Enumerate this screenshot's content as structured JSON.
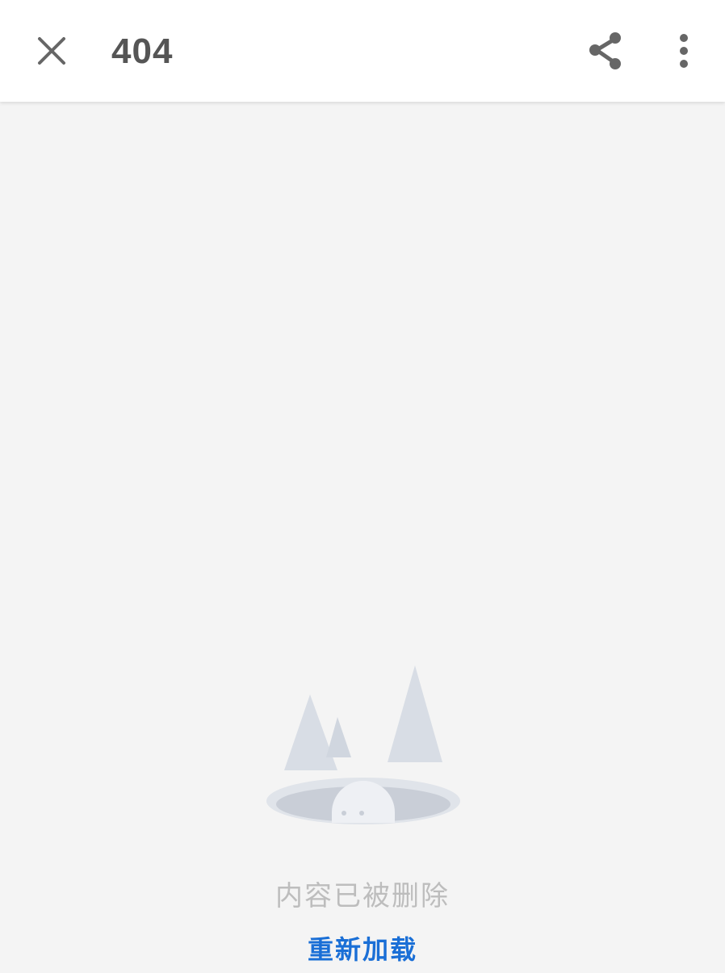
{
  "header": {
    "title": "404",
    "close_icon": "close-icon",
    "share_icon": "share-icon",
    "more_icon": "more-vertical-icon"
  },
  "empty_state": {
    "illustration": "empty-hole-illustration",
    "message": "内容已被删除",
    "reload_label": "重新加载"
  },
  "colors": {
    "background": "#f4f4f4",
    "topbar": "#ffffff",
    "icon": "#666666",
    "message": "#bdbdbd",
    "link": "#1a6fd6"
  }
}
